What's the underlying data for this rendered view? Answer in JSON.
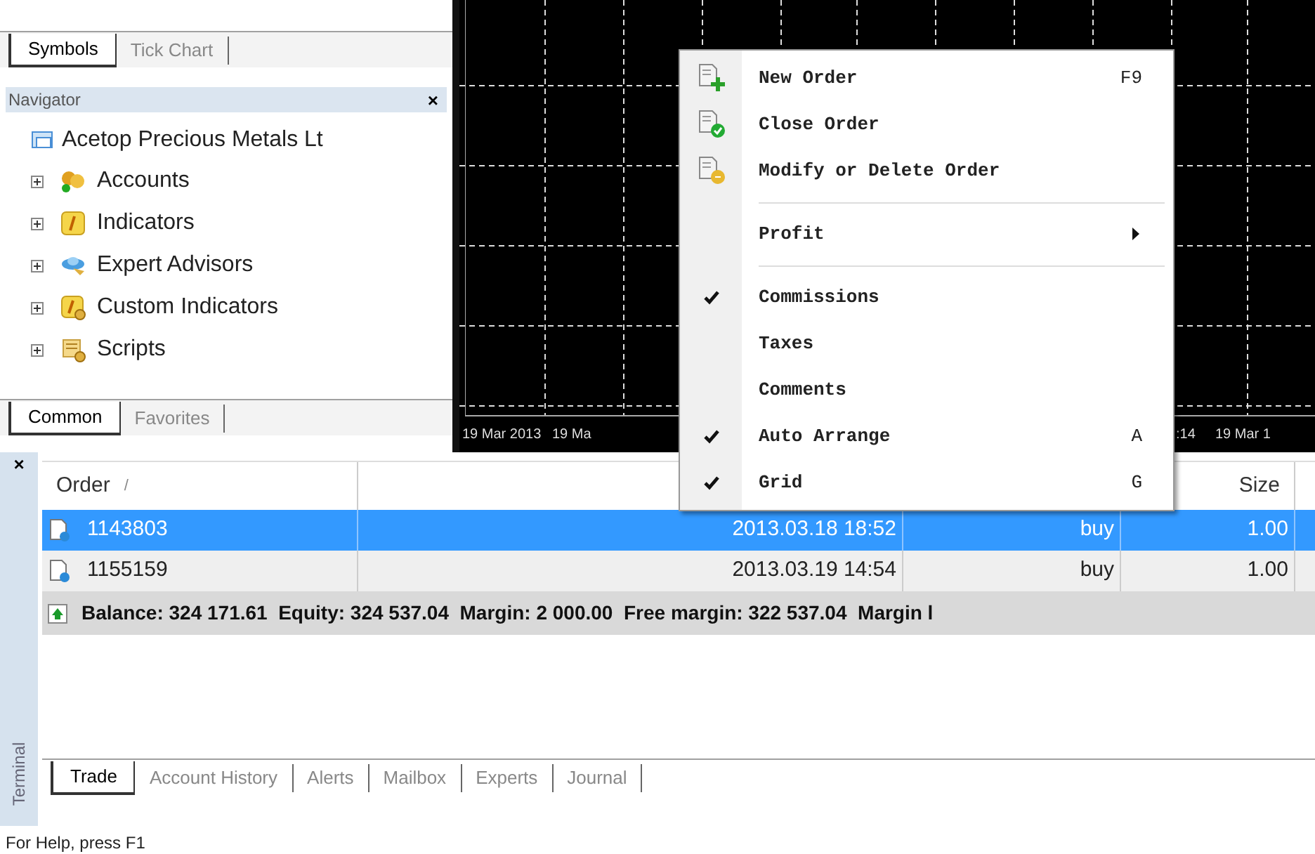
{
  "market_tabs": [
    {
      "label": "Symbols",
      "selected": true
    },
    {
      "label": "Tick Chart",
      "selected": false
    }
  ],
  "navigator": {
    "title": "Navigator",
    "close": "×",
    "root": {
      "label": "Acetop Precious Metals Lt",
      "children": [
        {
          "label": "Accounts",
          "expanded": false
        },
        {
          "label": "Indicators",
          "expanded": false
        },
        {
          "label": "Expert Advisors",
          "expanded": false
        },
        {
          "label": "Custom Indicators",
          "expanded": false
        },
        {
          "label": "Scripts",
          "expanded": false
        }
      ]
    }
  },
  "navigator_tabs": [
    {
      "label": "Common",
      "selected": true
    },
    {
      "label": "Favorites",
      "selected": false
    }
  ],
  "chart": {
    "time_axis_labels": [
      "19 Mar 2013",
      "19 Ma",
      ":14",
      "19 Mar 1"
    ]
  },
  "context_menu": {
    "items": [
      {
        "kind": "item",
        "label": "New Order",
        "shortcut": "F9",
        "checked": false
      },
      {
        "kind": "item",
        "label": "Close Order",
        "checked": false
      },
      {
        "kind": "item",
        "label": "Modify or Delete Order",
        "checked": false
      },
      {
        "kind": "separator"
      },
      {
        "kind": "submenu",
        "label": "Profit",
        "checked": false
      },
      {
        "kind": "separator"
      },
      {
        "kind": "item",
        "label": "Commissions",
        "checked": true
      },
      {
        "kind": "item",
        "label": "Taxes",
        "checked": false
      },
      {
        "kind": "item",
        "label": "Comments",
        "checked": false
      },
      {
        "kind": "item",
        "label": "Auto Arrange",
        "shortcut": "A",
        "checked": true
      },
      {
        "kind": "item",
        "label": "Grid",
        "shortcut": "G",
        "checked": true
      }
    ]
  },
  "terminal": {
    "title": "Terminal",
    "close": "×",
    "table": {
      "columns": [
        {
          "label": "Order",
          "sort_mark": "/"
        },
        {},
        {},
        {
          "label": "Size"
        }
      ],
      "rows": [
        {
          "selected": true,
          "cells": [
            "1143803",
            "2013.03.18 18:52",
            "buy",
            "1.00"
          ]
        },
        {
          "selected": false,
          "cells": [
            "1155159",
            "2013.03.19 14:54",
            "buy",
            "1.00"
          ]
        }
      ],
      "summary": "Balance: 324 171.61  Equity: 324 537.04  Margin: 2 000.00  Free margin: 322 537.04  Margin l"
    },
    "tabs": [
      {
        "label": "Trade",
        "selected": true
      },
      {
        "label": "Account History",
        "selected": false
      },
      {
        "label": "Alerts",
        "selected": false
      },
      {
        "label": "Mailbox",
        "selected": false
      },
      {
        "label": "Experts",
        "selected": false
      },
      {
        "label": "Journal",
        "selected": false
      }
    ]
  },
  "status_bar": "For Help, press F1"
}
